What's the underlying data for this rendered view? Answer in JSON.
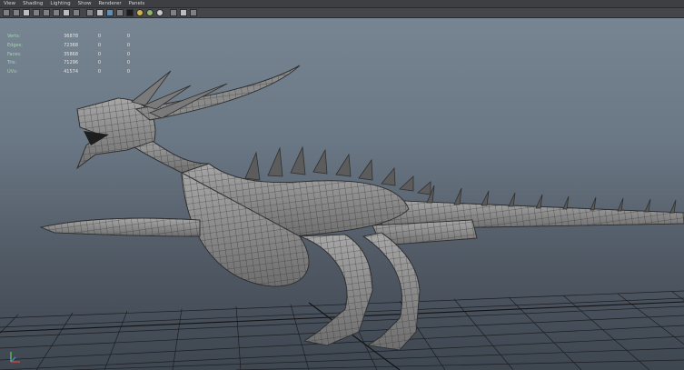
{
  "menubar": {
    "items": [
      {
        "label": "View"
      },
      {
        "label": "Shading"
      },
      {
        "label": "Lighting"
      },
      {
        "label": "Show"
      },
      {
        "label": "Renderer"
      },
      {
        "label": "Panels"
      }
    ]
  },
  "hud": {
    "rows": [
      {
        "label": "Verts:",
        "v1": "36878",
        "v2": "0",
        "v3": "0"
      },
      {
        "label": "Edges:",
        "v1": "72368",
        "v2": "0",
        "v3": "0"
      },
      {
        "label": "Faces:",
        "v1": "35868",
        "v2": "0",
        "v3": "0"
      },
      {
        "label": "Tris:",
        "v1": "71296",
        "v2": "0",
        "v3": "0"
      },
      {
        "label": "UVs:",
        "v1": "41574",
        "v2": "0",
        "v3": "0"
      }
    ]
  },
  "colors": {
    "viewport_top": "#778592",
    "viewport_bottom": "#3e4650",
    "hud_label": "#a9d1b7",
    "axis_x": "#d9473f",
    "axis_y": "#5fc25c",
    "axis_z": "#4f7fd6"
  },
  "icons": {
    "toolbar": [
      "camera-icon",
      "film-icon",
      "grid-icon",
      "wireframe-icon",
      "shaded-icon",
      "textured-icon",
      "light-icon",
      "shadow-icon",
      "isolate-icon",
      "xray-icon"
    ],
    "axis": "axis-gizmo-icon"
  }
}
